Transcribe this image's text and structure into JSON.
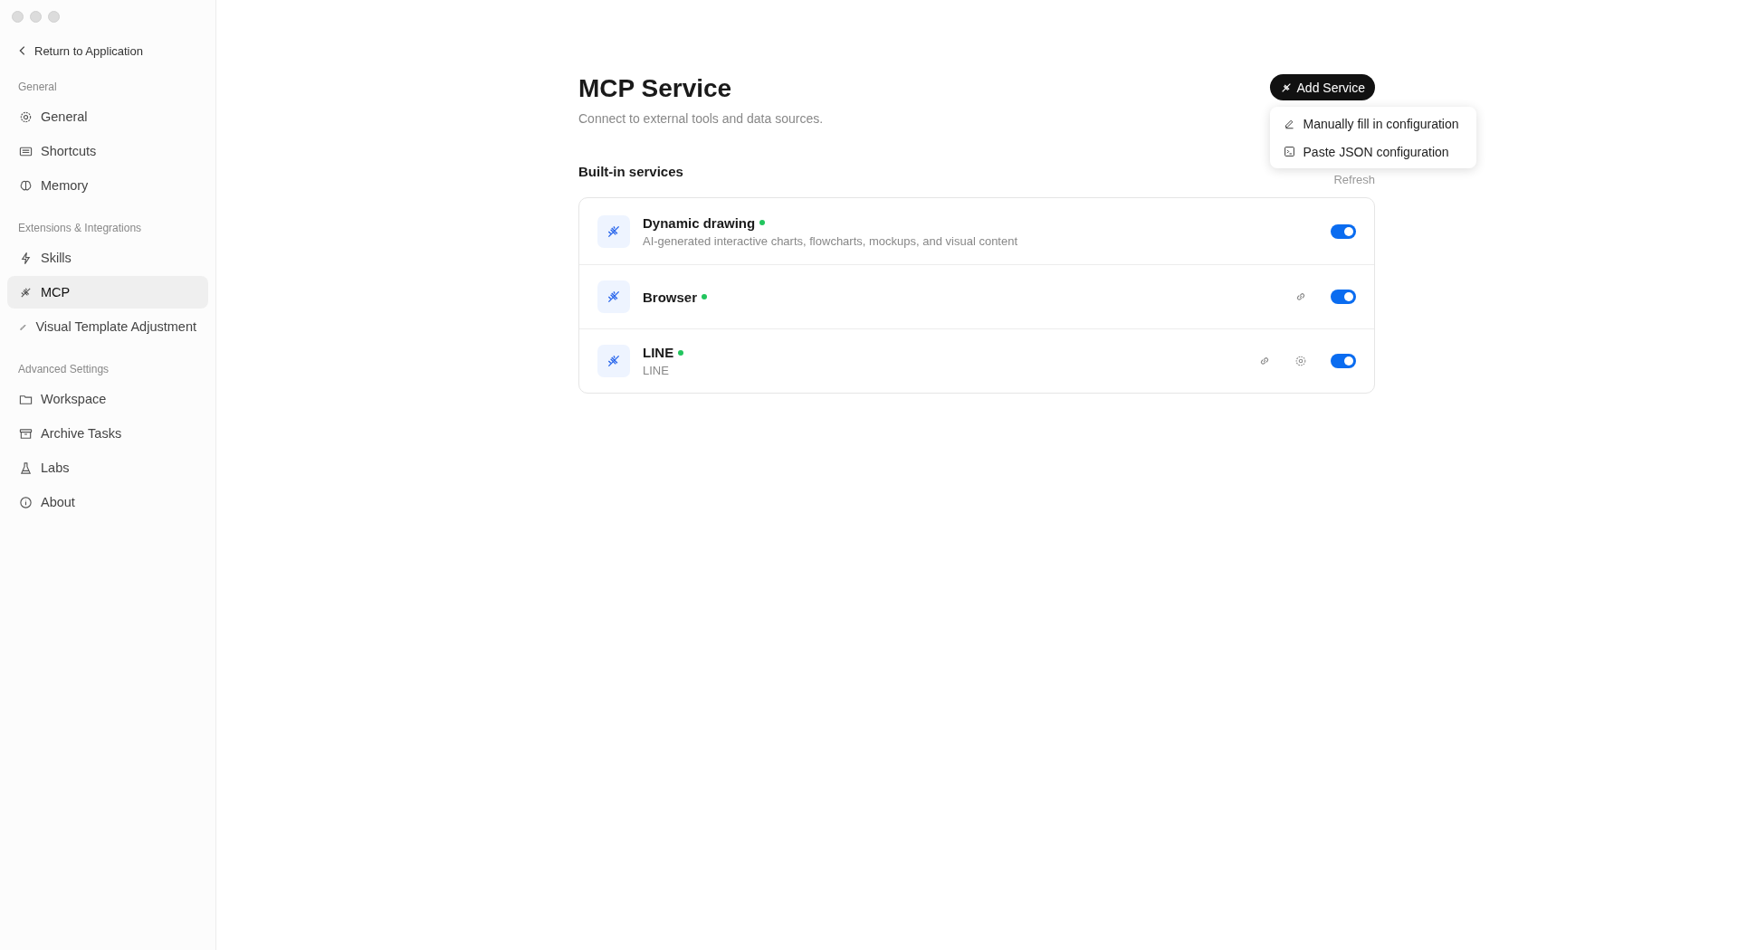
{
  "sidebar": {
    "back_link": "Return to Application",
    "sections": [
      {
        "heading": "General",
        "items": [
          {
            "label": "General",
            "selected": false
          },
          {
            "label": "Shortcuts",
            "selected": false
          },
          {
            "label": "Memory",
            "selected": false
          }
        ]
      },
      {
        "heading": "Extensions & Integrations",
        "items": [
          {
            "label": "Skills",
            "selected": false
          },
          {
            "label": "MCP",
            "selected": true
          },
          {
            "label": "Visual Template Adjustment",
            "selected": false
          }
        ]
      },
      {
        "heading": "Advanced Settings",
        "items": [
          {
            "label": "Workspace",
            "selected": false
          },
          {
            "label": "Archive Tasks",
            "selected": false
          },
          {
            "label": "Labs",
            "selected": false
          },
          {
            "label": "About",
            "selected": false
          }
        ]
      }
    ]
  },
  "page": {
    "title": "MCP Service",
    "subtitle": "Connect to external tools and data sources.",
    "add_button": "Add Service",
    "menu": [
      "Manually fill in configuration",
      "Paste JSON configuration"
    ],
    "section_title": "Built-in services",
    "refresh": "Refresh",
    "services": [
      {
        "name": "Dynamic drawing",
        "color": "#22c55e",
        "description": "AI-generated interactive charts, flowcharts, mockups, and visual content",
        "link": false,
        "settings": false,
        "on": true
      },
      {
        "name": "Browser",
        "color": "#22c55e",
        "link": true,
        "settings": false,
        "on": true
      },
      {
        "name": "LINE",
        "color": "#22c55e",
        "description": "LINE",
        "link": true,
        "settings": true,
        "on": true
      }
    ]
  }
}
